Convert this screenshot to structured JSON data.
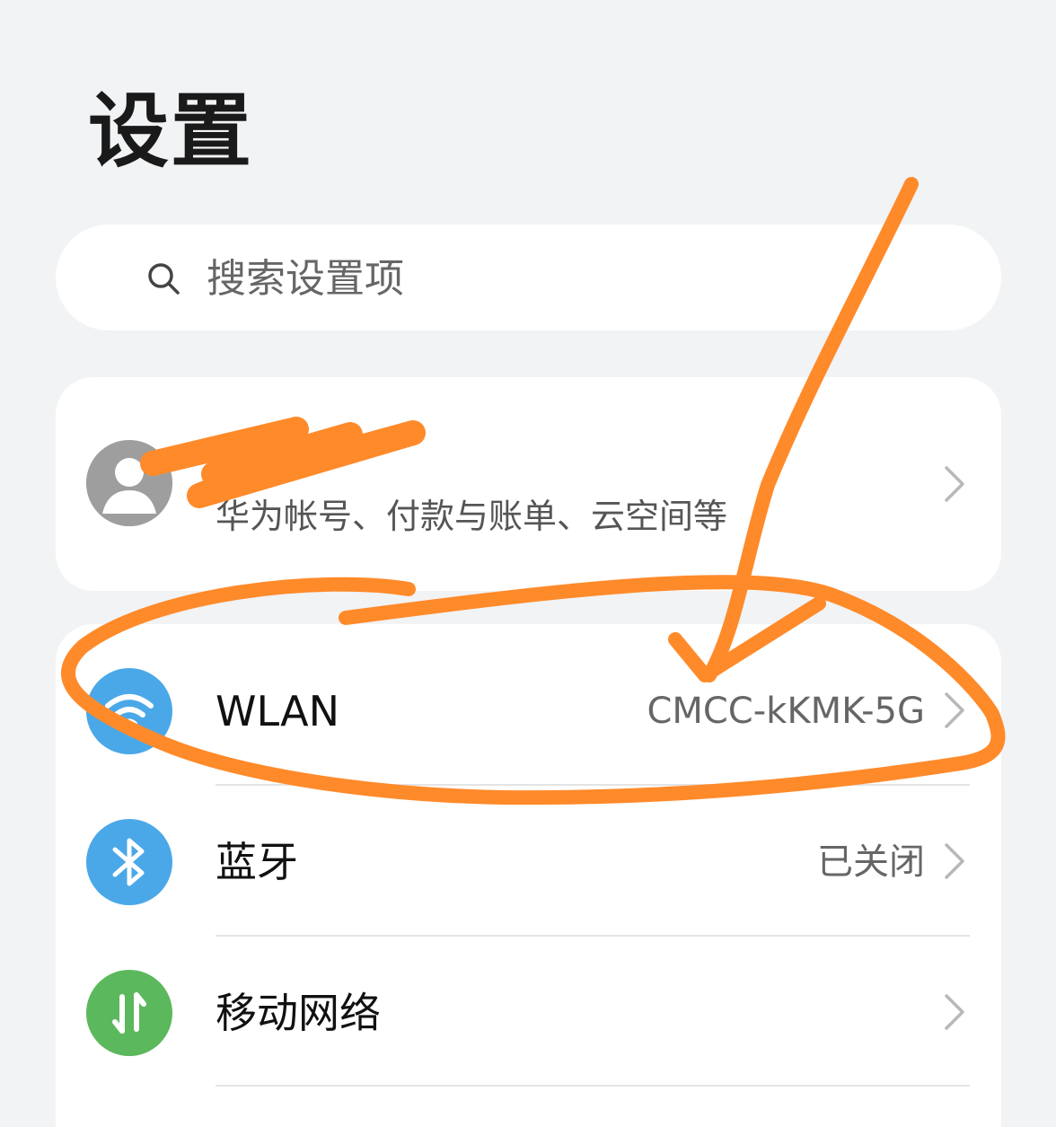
{
  "page": {
    "title": "设置"
  },
  "search": {
    "placeholder": "搜索设置项",
    "icon": "search-icon"
  },
  "account": {
    "name": "",
    "subtitle": "华为帐号、付款与账单、云空间等",
    "icon": "avatar-icon"
  },
  "settings": {
    "items": [
      {
        "label": "WLAN",
        "value": "CMCC-kKMK-5G",
        "icon": "wifi-icon",
        "color": "#4aa8e8"
      },
      {
        "label": "蓝牙",
        "value": "已关闭",
        "icon": "bluetooth-icon",
        "color": "#4aa8e8"
      },
      {
        "label": "移动网络",
        "value": "",
        "icon": "mobile-data-icon",
        "color": "#5cb85c"
      }
    ]
  },
  "colors": {
    "background": "#f1f3f5",
    "card": "#ffffff",
    "annotation": "#ff8a2a",
    "wlan": "#4aa8e8",
    "bluetooth": "#4aa8e8",
    "mobile": "#5cb85c"
  }
}
